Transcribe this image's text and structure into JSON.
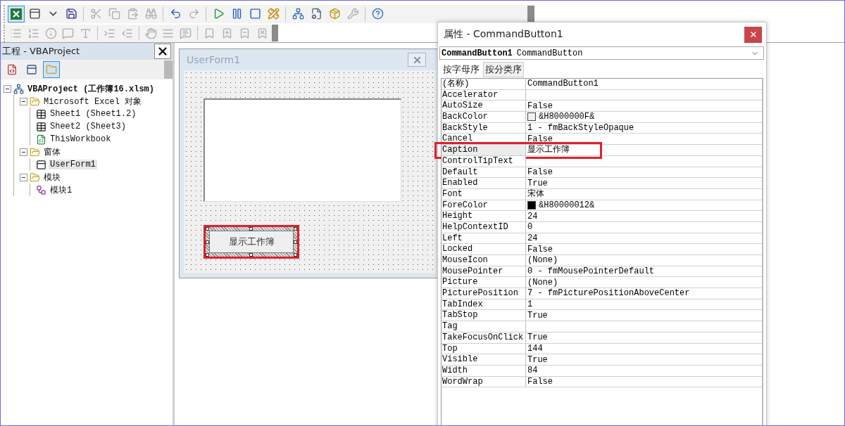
{
  "toolbars": [
    {
      "items": [
        {
          "kind": "excel",
          "pressed": true,
          "disabled": false
        },
        {
          "kind": "userform",
          "pressed": false,
          "disabled": false
        },
        {
          "kind": "caret",
          "pressed": false,
          "disabled": false
        },
        {
          "kind": "save",
          "pressed": false,
          "disabled": false
        },
        {
          "kind": "separator"
        },
        {
          "kind": "cut",
          "pressed": false,
          "disabled": true
        },
        {
          "kind": "copy",
          "pressed": false,
          "disabled": true
        },
        {
          "kind": "paste",
          "pressed": false,
          "disabled": true
        },
        {
          "kind": "find",
          "pressed": false,
          "disabled": true
        },
        {
          "kind": "separator"
        },
        {
          "kind": "undo",
          "pressed": false,
          "disabled": false
        },
        {
          "kind": "redo",
          "pressed": false,
          "disabled": true
        },
        {
          "kind": "separator"
        },
        {
          "kind": "run",
          "pressed": false,
          "disabled": false
        },
        {
          "kind": "pause",
          "pressed": false,
          "disabled": false
        },
        {
          "kind": "stop",
          "pressed": false,
          "disabled": false
        },
        {
          "kind": "design",
          "pressed": false,
          "disabled": false
        },
        {
          "kind": "separator"
        },
        {
          "kind": "explorer",
          "pressed": false,
          "disabled": false
        },
        {
          "kind": "properties",
          "pressed": false,
          "disabled": false
        },
        {
          "kind": "browser",
          "pressed": false,
          "disabled": false
        },
        {
          "kind": "toolbox",
          "pressed": false,
          "disabled": true
        },
        {
          "kind": "separator"
        },
        {
          "kind": "help",
          "pressed": false,
          "disabled": false
        }
      ]
    },
    {
      "items": [
        {
          "kind": "list-members",
          "pressed": false,
          "disabled": true
        },
        {
          "kind": "list-constants",
          "pressed": false,
          "disabled": true
        },
        {
          "kind": "quick-info",
          "pressed": false,
          "disabled": true
        },
        {
          "kind": "parameter-info",
          "pressed": false,
          "disabled": true
        },
        {
          "kind": "complete-word",
          "pressed": false,
          "disabled": true
        },
        {
          "kind": "separator"
        },
        {
          "kind": "indent",
          "pressed": false,
          "disabled": true
        },
        {
          "kind": "outdent",
          "pressed": false,
          "disabled": true
        },
        {
          "kind": "separator"
        },
        {
          "kind": "breakpoint",
          "pressed": false,
          "disabled": true
        },
        {
          "kind": "comment",
          "pressed": false,
          "disabled": true
        },
        {
          "kind": "uncomment",
          "pressed": false,
          "disabled": true
        },
        {
          "kind": "separator"
        },
        {
          "kind": "bookmark",
          "pressed": false,
          "disabled": true
        },
        {
          "kind": "next-bookmark",
          "pressed": false,
          "disabled": true
        },
        {
          "kind": "prev-bookmark",
          "pressed": false,
          "disabled": true
        },
        {
          "kind": "clear-bookmarks",
          "pressed": false,
          "disabled": true
        }
      ]
    }
  ],
  "project": {
    "title": "工程 - VBAProject",
    "view_buttons": [
      {
        "kind": "view-code",
        "pressed": false
      },
      {
        "kind": "view-object",
        "pressed": false
      },
      {
        "kind": "toggle-folders",
        "pressed": true
      }
    ],
    "tree": [
      {
        "label": "VBAProject (工作簿16.xlsm)",
        "kind": "project",
        "bold": true,
        "selected": false,
        "expanded": true,
        "children": [
          {
            "label": "Microsoft Excel 对象",
            "kind": "folder",
            "bold": false,
            "selected": false,
            "expanded": true,
            "children": [
              {
                "label": "Sheet1 (Sheet1.2)",
                "kind": "sheet",
                "bold": false,
                "selected": false
              },
              {
                "label": "Sheet2 (Sheet3)",
                "kind": "sheet",
                "bold": false,
                "selected": false
              },
              {
                "label": "ThisWorkbook",
                "kind": "workbook",
                "bold": false,
                "selected": false
              }
            ]
          },
          {
            "label": "窗体",
            "kind": "folder",
            "bold": false,
            "selected": false,
            "expanded": true,
            "children": [
              {
                "label": "UserForm1",
                "kind": "form",
                "bold": false,
                "selected": true
              }
            ]
          },
          {
            "label": "模块",
            "kind": "folder",
            "bold": false,
            "selected": false,
            "expanded": true,
            "children": [
              {
                "label": "模块1",
                "kind": "module",
                "bold": false,
                "selected": false
              }
            ]
          }
        ]
      }
    ]
  },
  "designer": {
    "title": "UserForm1",
    "controls": [
      {
        "kind": "listbox"
      },
      {
        "kind": "button",
        "caption": "显示工作簿",
        "selected": true,
        "highlighted": true
      }
    ]
  },
  "properties": {
    "title": "属性 - CommandButton1",
    "object_name": "CommandButton1",
    "object_type": "CommandButton",
    "tabs": [
      {
        "label": "按字母序",
        "selected": true
      },
      {
        "label": "按分类序",
        "selected": false
      }
    ],
    "rows": [
      {
        "name": "(名称)",
        "value": "CommandButton1",
        "selected": false,
        "highlighted": false
      },
      {
        "name": "Accelerator",
        "value": "",
        "selected": false,
        "highlighted": false
      },
      {
        "name": "AutoSize",
        "value": "False",
        "selected": false,
        "highlighted": false
      },
      {
        "name": "BackColor",
        "value": "&H8000000F&",
        "color": "#f0f0f0",
        "selected": false,
        "highlighted": false
      },
      {
        "name": "BackStyle",
        "value": "1 - fmBackStyleOpaque",
        "selected": false,
        "highlighted": false
      },
      {
        "name": "Cancel",
        "value": "False",
        "selected": false,
        "highlighted": false
      },
      {
        "name": "Caption",
        "value": "显示工作簿",
        "selected": true,
        "highlighted": true
      },
      {
        "name": "ControlTipText",
        "value": "",
        "selected": false,
        "highlighted": false
      },
      {
        "name": "Default",
        "value": "False",
        "selected": false,
        "highlighted": false
      },
      {
        "name": "Enabled",
        "value": "True",
        "selected": false,
        "highlighted": false
      },
      {
        "name": "Font",
        "value": "宋体",
        "selected": false,
        "highlighted": false
      },
      {
        "name": "ForeColor",
        "value": "&H80000012&",
        "color": "#000000",
        "selected": false,
        "highlighted": false
      },
      {
        "name": "Height",
        "value": "24",
        "selected": false,
        "highlighted": false
      },
      {
        "name": "HelpContextID",
        "value": "0",
        "selected": false,
        "highlighted": false
      },
      {
        "name": "Left",
        "value": "24",
        "selected": false,
        "highlighted": false
      },
      {
        "name": "Locked",
        "value": "False",
        "selected": false,
        "highlighted": false
      },
      {
        "name": "MouseIcon",
        "value": "(None)",
        "selected": false,
        "highlighted": false
      },
      {
        "name": "MousePointer",
        "value": "0 - fmMousePointerDefault",
        "selected": false,
        "highlighted": false
      },
      {
        "name": "Picture",
        "value": "(None)",
        "selected": false,
        "highlighted": false
      },
      {
        "name": "PicturePosition",
        "value": "7 - fmPicturePositionAboveCenter",
        "selected": false,
        "highlighted": false
      },
      {
        "name": "TabIndex",
        "value": "1",
        "selected": false,
        "highlighted": false
      },
      {
        "name": "TabStop",
        "value": "True",
        "selected": false,
        "highlighted": false
      },
      {
        "name": "Tag",
        "value": "",
        "selected": false,
        "highlighted": false
      },
      {
        "name": "TakeFocusOnClick",
        "value": "True",
        "selected": false,
        "highlighted": false
      },
      {
        "name": "Top",
        "value": "144",
        "selected": false,
        "highlighted": false
      },
      {
        "name": "Visible",
        "value": "True",
        "selected": false,
        "highlighted": false
      },
      {
        "name": "Width",
        "value": "84",
        "selected": false,
        "highlighted": false
      },
      {
        "name": "WordWrap",
        "value": "False",
        "selected": false,
        "highlighted": false
      }
    ]
  }
}
